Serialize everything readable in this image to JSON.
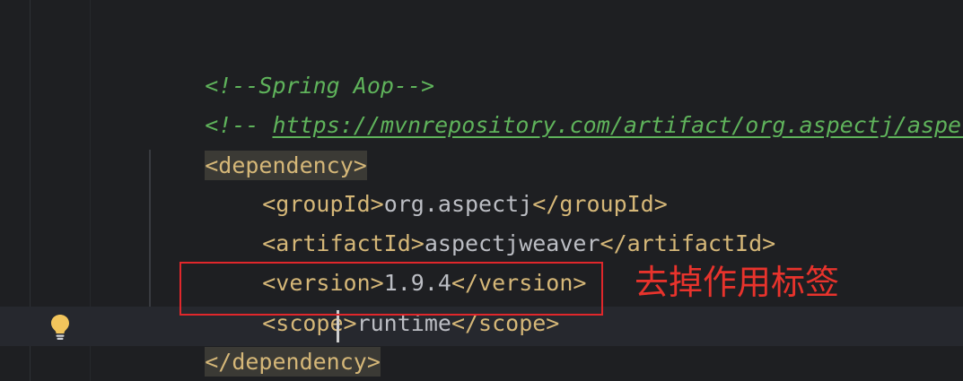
{
  "editor": {
    "lines": {
      "comment_spring": "<!--Spring Aop-->",
      "comment_prefix": "<!-- ",
      "comment_url": "https://mvnrepository.com/artifact/org.aspectj/aspec",
      "dependency_open": "<dependency>",
      "groupId_open": "<groupId>",
      "groupId_value": "org.aspectj",
      "groupId_close": "</groupId>",
      "artifactId_open": "<artifactId>",
      "artifactId_value": "aspectjweaver",
      "artifactId_close": "</artifactId>",
      "version_open": "<version>",
      "version_value": "1.9.4",
      "version_close": "</version>",
      "scope_open": "<scope>",
      "scope_value": "runtime",
      "scope_close": "</scope>",
      "dependency_close": "</dependency>"
    }
  },
  "annotation": {
    "label": "去掉作用标签",
    "color": "#e0272b"
  },
  "colors": {
    "background": "#1e1f22",
    "comment": "#5fb35b",
    "tag": "#d5b778",
    "text": "#bcbec4"
  },
  "icons": {
    "gutter_icon": "lightbulb-icon"
  }
}
